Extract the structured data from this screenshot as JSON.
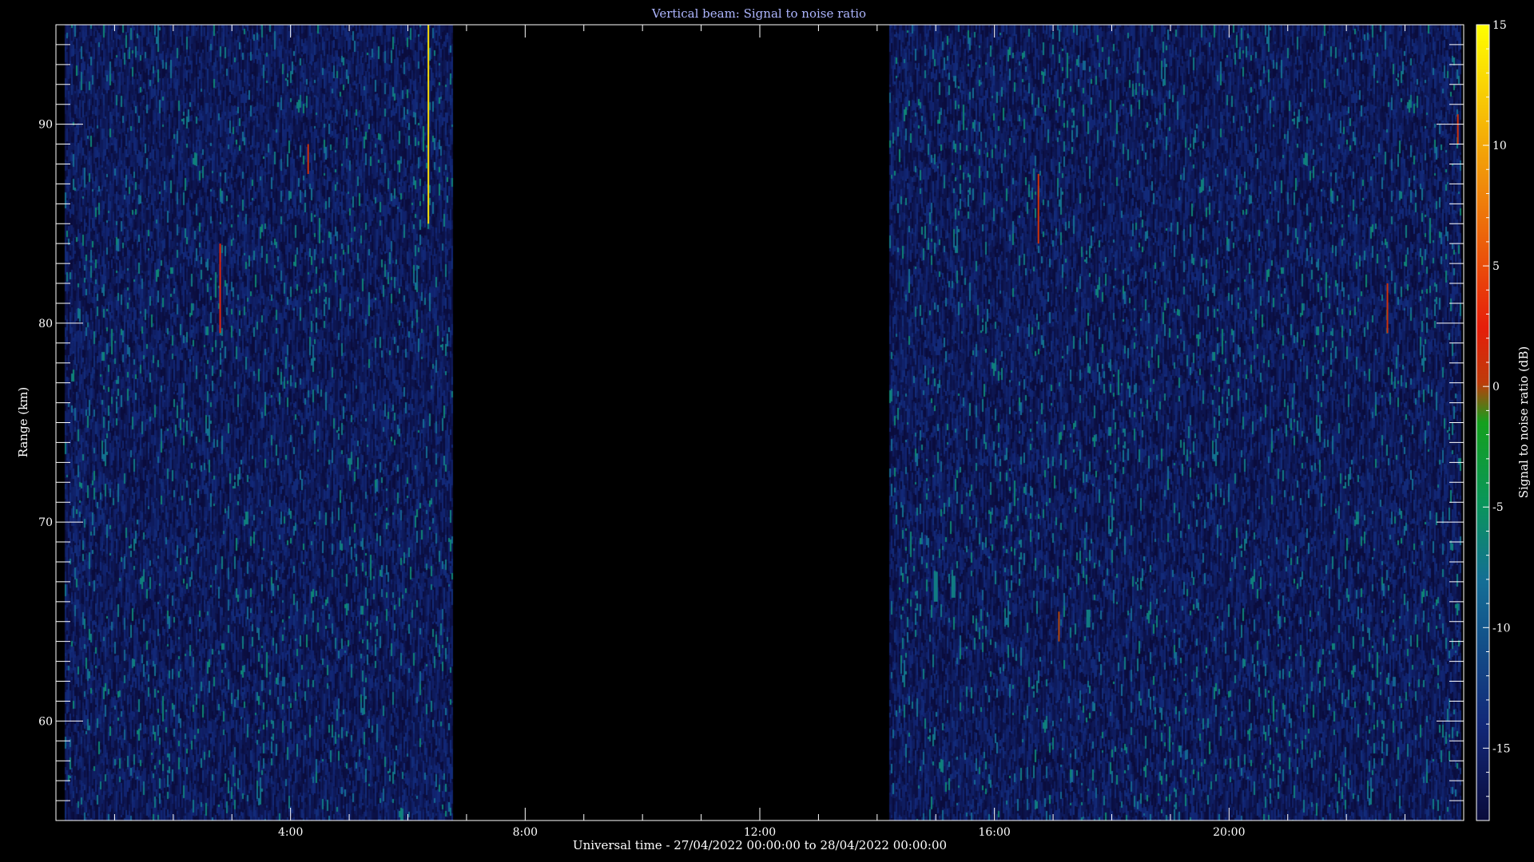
{
  "chart_data": {
    "type": "heatmap",
    "title": "Vertical beam: Signal to noise ratio",
    "xlabel": "Universal time - 27/04/2022 00:00:00 to 28/04/2022 00:00:00",
    "ylabel": "Range (km)",
    "colorbar_label": "Signal to noise ratio (dB)",
    "x_unit": "hours UT",
    "xlim": [
      0,
      24
    ],
    "ylim": [
      55,
      95
    ],
    "x_ticks": [
      {
        "value": 4,
        "label": "4:00"
      },
      {
        "value": 8,
        "label": "8:00"
      },
      {
        "value": 12,
        "label": "12:00"
      },
      {
        "value": 16,
        "label": "16:00"
      },
      {
        "value": 20,
        "label": "20:00"
      }
    ],
    "y_ticks": [
      {
        "value": 60,
        "label": "60"
      },
      {
        "value": 70,
        "label": "70"
      },
      {
        "value": 80,
        "label": "80"
      },
      {
        "value": 90,
        "label": "90"
      }
    ],
    "clim": [
      -18,
      15
    ],
    "colorbar_ticks": [
      {
        "value": 15,
        "label": "15"
      },
      {
        "value": 10,
        "label": "10"
      },
      {
        "value": 5,
        "label": "5"
      },
      {
        "value": 0,
        "label": "0"
      },
      {
        "value": -5,
        "label": "-5"
      },
      {
        "value": -10,
        "label": "-10"
      },
      {
        "value": -15,
        "label": "-15"
      }
    ],
    "data_gaps": [
      {
        "start": 6.75,
        "end": 14.2
      }
    ],
    "background_level_db": -16,
    "features": [
      {
        "time": 2.8,
        "range_min": 79.5,
        "range_max": 84,
        "snr": 2
      },
      {
        "time": 4.3,
        "range_min": 87.5,
        "range_max": 89,
        "snr": 1
      },
      {
        "time": 6.35,
        "range_min": 85,
        "range_max": 95,
        "snr": 13
      },
      {
        "time": 15.0,
        "range_min": 66,
        "range_max": 67.5,
        "snr": -7
      },
      {
        "time": 15.3,
        "range_min": 66.2,
        "range_max": 67.3,
        "snr": -7
      },
      {
        "time": 16.75,
        "range_min": 84,
        "range_max": 87.5,
        "snr": 1
      },
      {
        "time": 17.1,
        "range_min": 64,
        "range_max": 65.5,
        "snr": 0
      },
      {
        "time": 17.6,
        "range_min": 64.7,
        "range_max": 65.6,
        "snr": -7
      },
      {
        "time": 22.7,
        "range_min": 79.5,
        "range_max": 82,
        "snr": 1
      },
      {
        "time": 23.9,
        "range_min": 89,
        "range_max": 90.5,
        "snr": 1
      }
    ]
  }
}
